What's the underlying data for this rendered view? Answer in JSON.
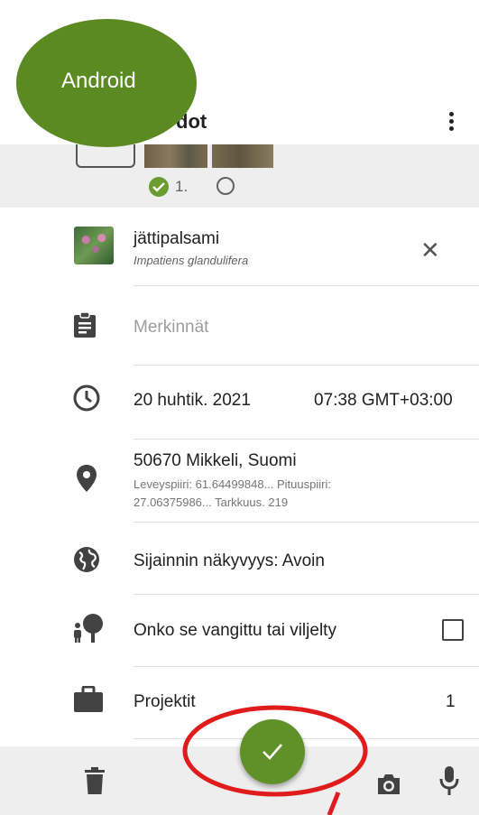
{
  "header": {
    "title": "Havainnot",
    "title_visible": "dot"
  },
  "badge": {
    "label": "Android"
  },
  "photos": {
    "selected_label": "1."
  },
  "species": {
    "common_name": "jättipalsami",
    "scientific_name": "Impatiens glandulifera"
  },
  "notes": {
    "placeholder": "Merkinnät"
  },
  "datetime": {
    "date": "20 huhtik. 2021",
    "time": "07:38 GMT+03:00"
  },
  "location": {
    "place": "50670 Mikkeli, Suomi",
    "details_line1": "Leveyspiiri: 61.64499848...  Pituuspiiri:",
    "details_line2": "27.06375986...  Tarkkuus. 219"
  },
  "visibility": {
    "label": "Sijainnin näkyvyys: Avoin"
  },
  "captive": {
    "label": "Onko se vangittu tai viljelty"
  },
  "projects": {
    "label": "Projektit",
    "count": "1"
  },
  "colors": {
    "accent": "#5f9128",
    "badge": "#5b8a22",
    "annotation": "#e01b1b"
  },
  "icons": [
    "more-vert-icon",
    "check-icon",
    "close-icon",
    "clipboard-icon",
    "clock-icon",
    "location-pin-icon",
    "globe-icon",
    "tree-person-icon",
    "briefcase-icon",
    "trash-icon",
    "camera-icon",
    "microphone-icon"
  ]
}
